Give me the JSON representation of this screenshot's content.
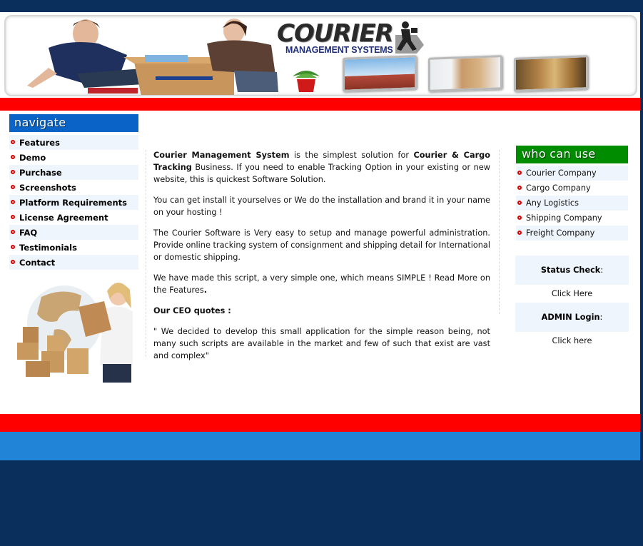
{
  "header": {
    "logo_title": "COURIER",
    "logo_subtitle": "MANAGEMENT SYSTEMS",
    "banner_images": [
      "people-unpacking-box",
      "potted-plant",
      "airplane-over-roof",
      "mover-with-boxes",
      "workers-carrying-boxes"
    ]
  },
  "sidebar": {
    "title": "navigate",
    "items": [
      {
        "label": "Features"
      },
      {
        "label": "Demo"
      },
      {
        "label": "Purchase"
      },
      {
        "label": "Screenshots"
      },
      {
        "label": "Platform Requirements"
      },
      {
        "label": "License Agreement"
      },
      {
        "label": "FAQ"
      },
      {
        "label": "Testimonials"
      },
      {
        "label": "Contact"
      }
    ],
    "promo_image": "woman-with-boxes-and-globe"
  },
  "main": {
    "p1": {
      "b1": "Courier Management System",
      "t1": " is the simplest solution for ",
      "b2": "Courier & Cargo Tracking",
      "t2": " Business. If you need to enable Tracking Option in your existing or new website, this is quickest Software Solution."
    },
    "p2": "You can get install it yourselves or We do the installation and brand it in your name on your hosting !",
    "p3": "The Courier Software is Very easy to setup and manage powerful administration. Provide online tracking system of consignment and shipping detail for International or domestic shipping.",
    "p4": {
      "t1": "We have made this script, a very simple one, which means SIMPLE ! Read More on the Features",
      "b1": "."
    },
    "ceo_heading": "Our CEO quotes :",
    "ceo_quote": "\" We decided to develop this small application for the simple reason being, not many such scripts are available in the market and few of such that exist are vast and complex\""
  },
  "right": {
    "title": "who can use",
    "items": [
      {
        "label": "Courier Company"
      },
      {
        "label": "Cargo Company"
      },
      {
        "label": "Any Logistics"
      },
      {
        "label": "Shipping Company"
      },
      {
        "label": "Freight Company"
      }
    ],
    "status_check": {
      "label": "Status Check",
      "suffix": " :",
      "link": "Click Here"
    },
    "admin_login": {
      "label": "ADMIN Login",
      "suffix": " :",
      "link": "Click here"
    }
  },
  "colors": {
    "navy": "#0b2f5c",
    "red": "#ff0000",
    "nav_blue": "#0a64c8",
    "who_green": "#008c00",
    "footer_blue": "#2284d6",
    "row_tint": "#eef5fc",
    "bullet_red": "#e00000"
  }
}
